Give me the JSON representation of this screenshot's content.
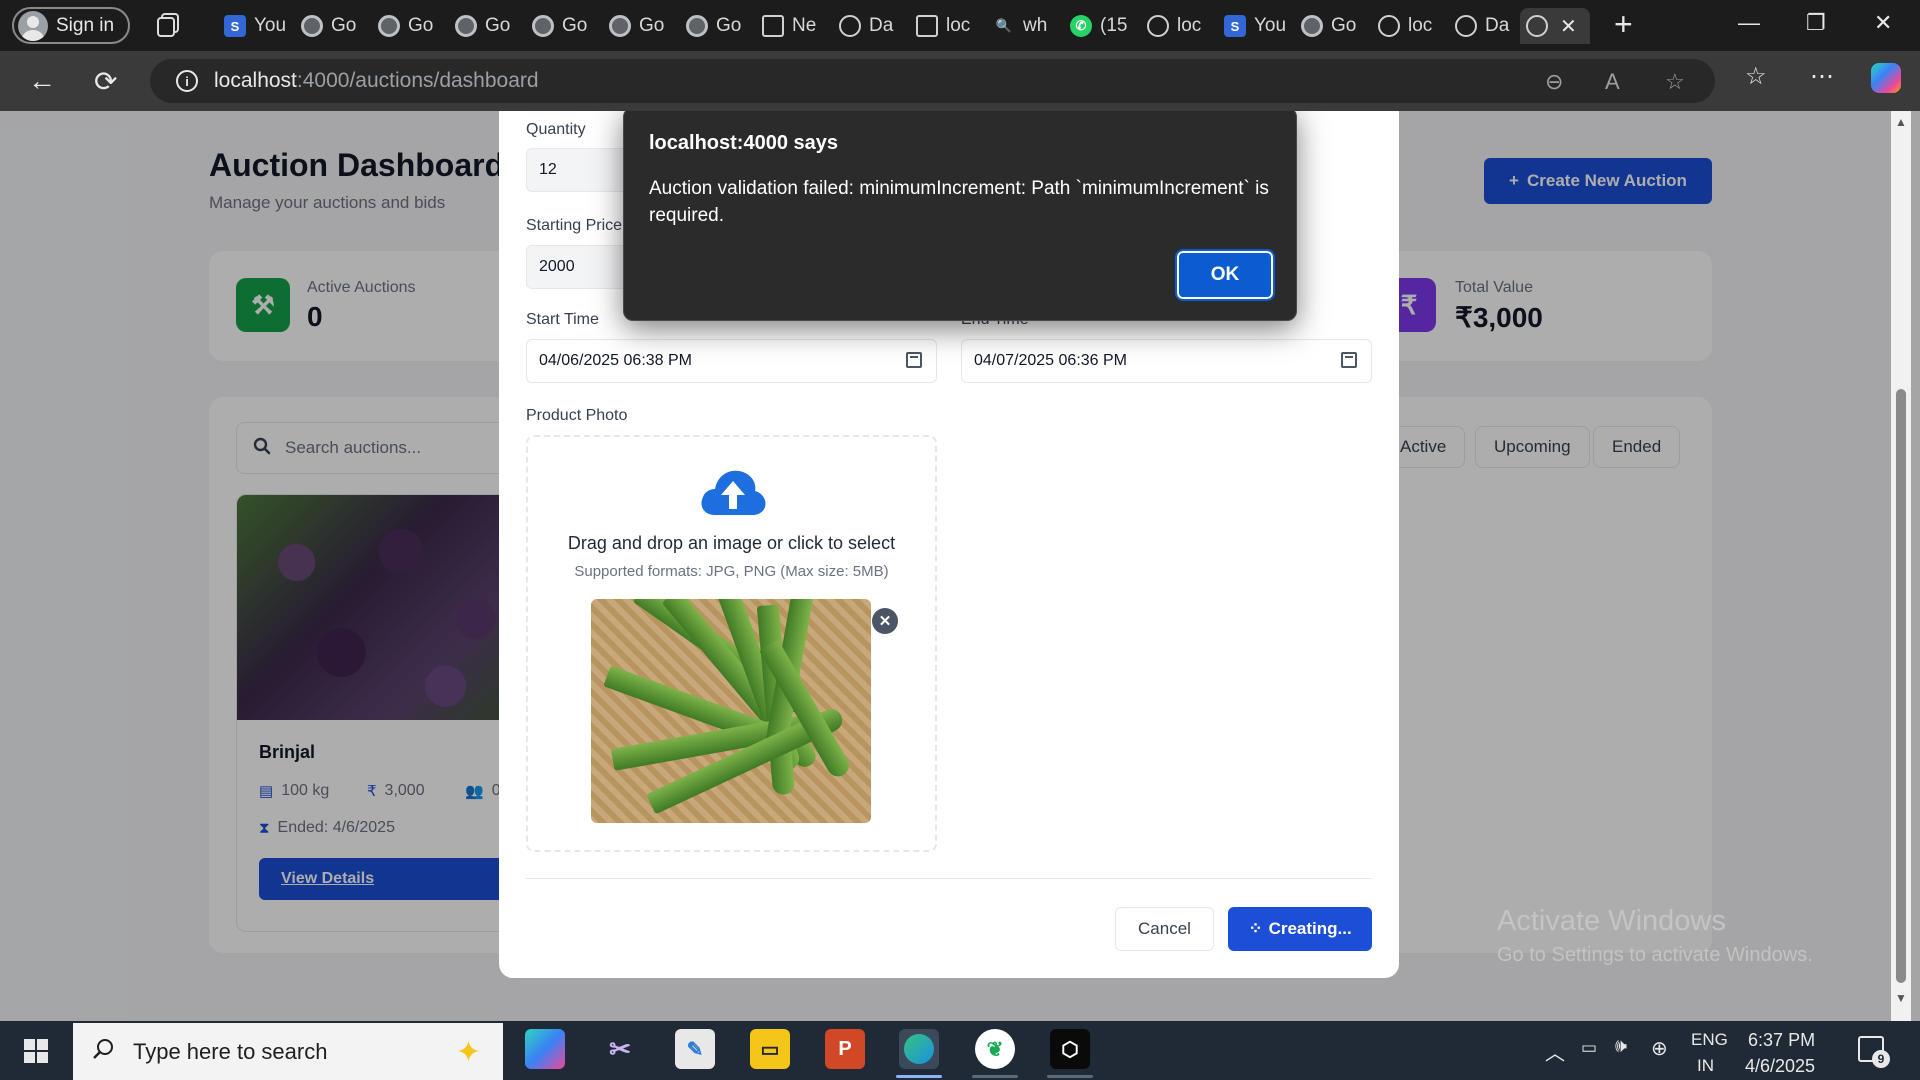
{
  "browser": {
    "signin_label": "Sign in",
    "tabs": [
      {
        "icon": "s-icon",
        "label": "You"
      },
      {
        "icon": "google-icon",
        "label": "Go"
      },
      {
        "icon": "google-icon",
        "label": "Go"
      },
      {
        "icon": "google-icon",
        "label": "Go"
      },
      {
        "icon": "google-icon",
        "label": "Go"
      },
      {
        "icon": "google-icon",
        "label": "Go"
      },
      {
        "icon": "google-icon",
        "label": "Go"
      },
      {
        "icon": "document-icon",
        "label": "Ne"
      },
      {
        "icon": "globe-icon",
        "label": "Da"
      },
      {
        "icon": "file-icon",
        "label": "loc"
      },
      {
        "icon": "search-icon",
        "label": "wh"
      },
      {
        "icon": "whatsapp-icon",
        "label": "(15"
      },
      {
        "icon": "globe-icon",
        "label": "loc"
      },
      {
        "icon": "s-icon",
        "label": "You"
      },
      {
        "icon": "google-icon",
        "label": "Go"
      },
      {
        "icon": "globe-icon",
        "label": "loc"
      },
      {
        "icon": "globe-icon",
        "label": "Da"
      }
    ],
    "url_host": "localhost",
    "url_rest": ":4000/auctions/dashboard"
  },
  "dashboard": {
    "title": "Auction Dashboard",
    "subtitle": "Manage your auctions and bids",
    "create_button": "Create New Auction",
    "stats": {
      "active_label": "Active Auctions",
      "active_value": "0",
      "total_label": "Total Value",
      "total_value": "₹3,000"
    },
    "search_placeholder": "Search auctions...",
    "filters": [
      "Active",
      "Upcoming",
      "Ended"
    ],
    "card": {
      "title": "Brinjal",
      "quantity": "100 kg",
      "price": "3,000",
      "bidders": "0",
      "status": "Ended: 4/6/2025",
      "view_button": "View Details"
    }
  },
  "form": {
    "quantity_label": "Quantity",
    "quantity_value": "12",
    "starting_price_label": "Starting Price",
    "starting_price_value": "2000",
    "start_time_label": "Start Time",
    "start_time_value": "04/06/2025 06:38 PM",
    "end_time_label": "End Time",
    "end_time_value": "04/07/2025 06:36 PM",
    "photo_label": "Product Photo",
    "dropzone_title": "Drag and drop an image or click to select",
    "dropzone_sub": "Supported formats: JPG, PNG (Max size: 5MB)",
    "cancel_label": "Cancel",
    "submit_label": "Creating..."
  },
  "alert": {
    "title": "localhost:4000 says",
    "message": "Auction validation failed: minimumIncrement: Path `minimumIncrement` is required.",
    "ok_label": "OK"
  },
  "watermark": {
    "line1": "Activate Windows",
    "line2": "Go to Settings to activate Windows."
  },
  "taskbar": {
    "search_placeholder": "Type here to search",
    "language": "ENG",
    "region": "IN",
    "time": "6:37 PM",
    "date": "4/6/2025",
    "notifications": "9"
  }
}
